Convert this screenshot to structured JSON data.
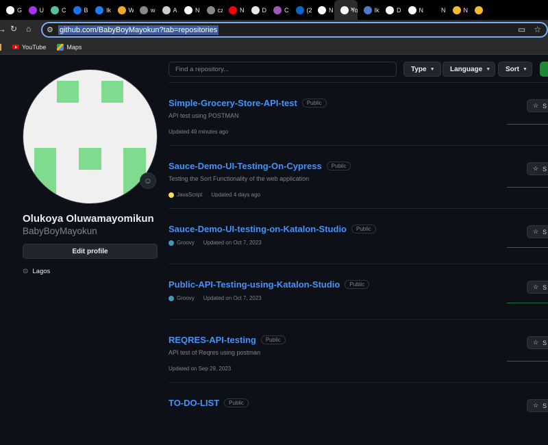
{
  "tabs": [
    {
      "label": "G",
      "icon": "github-icon",
      "color": "#ffffff"
    },
    {
      "label": "U",
      "icon": "udemy-icon",
      "color": "#a435f0"
    },
    {
      "label": "C",
      "icon": "doc-icon",
      "color": "#4fc3a1"
    },
    {
      "label": "B",
      "icon": "bar-icon",
      "color": "#1a73e8"
    },
    {
      "label": "Ik",
      "icon": "profile-icon",
      "color": "#1b7ff0"
    },
    {
      "label": "W",
      "icon": "hb-icon",
      "color": "#f5a623"
    },
    {
      "label": "w",
      "icon": "globe-icon",
      "color": "#888888"
    },
    {
      "label": "A",
      "icon": "chatgpt-icon",
      "color": "#cccccc"
    },
    {
      "label": "N",
      "icon": "github-icon",
      "color": "#ffffff"
    },
    {
      "label": "cz",
      "icon": "globe-icon",
      "color": "#888888"
    },
    {
      "label": "N",
      "icon": "youtube-icon",
      "color": "#ff0000"
    },
    {
      "label": "D",
      "icon": "download-icon",
      "color": "#e8e8e8"
    },
    {
      "label": "C",
      "icon": "copilot-icon",
      "color": "#9b59b6"
    },
    {
      "label": "(2",
      "icon": "linkedin-icon",
      "color": "#0a66c2"
    },
    {
      "label": "N",
      "icon": "github-icon",
      "color": "#ffffff"
    },
    {
      "label": "Yo",
      "icon": "github-icon",
      "color": "#ffffff",
      "active": true
    },
    {
      "label": "Ik",
      "icon": "globe-icon",
      "color": "#4a7bd0"
    },
    {
      "label": "D",
      "icon": "github-icon",
      "color": "#ffffff"
    },
    {
      "label": "N",
      "icon": "github-icon",
      "color": "#ffffff"
    },
    {
      "label": "N",
      "icon": "none",
      "color": "#000000"
    },
    {
      "label": "N",
      "icon": "binance-icon",
      "color": "#f3ba2f"
    },
    {
      "label": "",
      "icon": "binance-icon",
      "color": "#f3ba2f"
    }
  ],
  "address_bar": {
    "url": "github.com/BabyBoyMayokun?tab=repositories"
  },
  "bookmarks": [
    {
      "label": "YouTube",
      "icon": "youtube-icon"
    },
    {
      "label": "Maps",
      "icon": "maps-icon"
    }
  ],
  "profile": {
    "full_name": "Olukoya Oluwamayomikun",
    "username": "BabyBoyMayokun",
    "edit_label": "Edit profile",
    "location": "Lagos",
    "avatar_color": "#7fdc8f"
  },
  "filters": {
    "search_placeholder": "Find a repository...",
    "type_label": "Type",
    "language_label": "Language",
    "sort_label": "Sort"
  },
  "repos": [
    {
      "name": "Simple-Grocery-Store-API-test",
      "visibility": "Public",
      "description": "API test using POSTMAN",
      "language": "",
      "lang_color": "",
      "updated": "Updated 49 minutes ago"
    },
    {
      "name": "Sauce-Demo-UI-Testing-On-Cypress",
      "visibility": "Public",
      "description": "Testing the Sort Functionality of the web application",
      "language": "JavaScript",
      "lang_color": "#f1e05a",
      "updated": "Updated 4 days ago"
    },
    {
      "name": "Sauce-Demo-UI-testing-on-Katalon-Studio",
      "visibility": "Public",
      "description": "",
      "language": "Groovy",
      "lang_color": "#4298b8",
      "updated": "Updated on Oct 7, 2023"
    },
    {
      "name": "Public-API-Testing-using-Katalon-Studio",
      "visibility": "Public",
      "description": "",
      "language": "Groovy",
      "lang_color": "#4298b8",
      "updated": "Updated on Oct 7, 2023"
    },
    {
      "name": "REQRES-API-testing",
      "visibility": "Public",
      "description": "API test of Reqres using postman",
      "language": "",
      "lang_color": "",
      "updated": "Updated on Sep 29, 2023"
    },
    {
      "name": "TO-DO-LIST",
      "visibility": "Public",
      "description": "",
      "language": "",
      "lang_color": "",
      "updated": ""
    }
  ],
  "star_label": "S"
}
